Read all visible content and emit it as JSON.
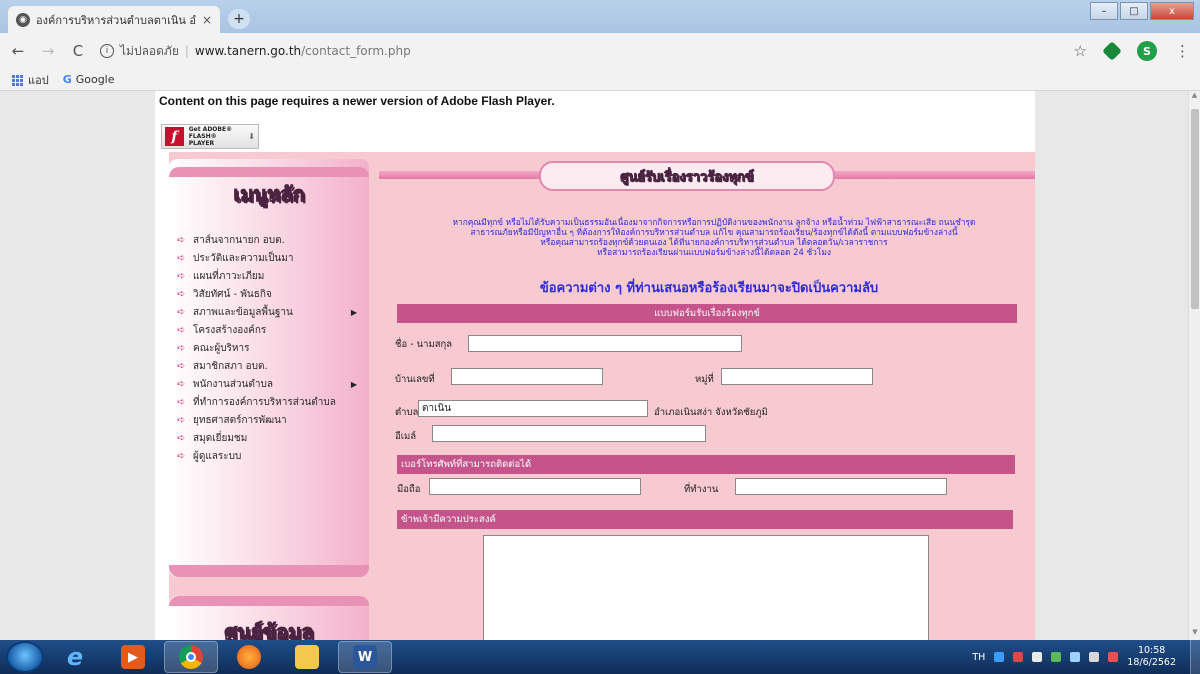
{
  "browser": {
    "tab_title": "องค์การบริหารส่วนตำบลตาเนิน อำเภอ",
    "tab_close": "×",
    "new_tab": "+",
    "not_secure": "ไม่ปลอดภัย",
    "domain": "www.tanern.go.th",
    "path": "/contact_form.php",
    "profile_letter": "S",
    "window_controls": [
      "–",
      "□",
      "x"
    ]
  },
  "bookmarks": {
    "apps_label": "แอป",
    "google_label": "Google"
  },
  "flash": {
    "message": "Content on this page requires a newer version of Adobe Flash Player.",
    "badge_line1": "Get ADOBE®",
    "badge_line2": "FLASH® PLAYER"
  },
  "sidebar": {
    "title": "เมนูหลัก",
    "items": [
      {
        "label": "สาส์นจากนายก อบต.",
        "has_sub": false
      },
      {
        "label": "ประวัติและความเป็นมา",
        "has_sub": false
      },
      {
        "label": "แผนที่ภาวะเภียม",
        "has_sub": false
      },
      {
        "label": "วิสัยทัศน์ - พันธกิจ",
        "has_sub": false
      },
      {
        "label": "สภาพและข้อมูลพื้นฐาน",
        "has_sub": true
      },
      {
        "label": "โครงสร้างองค์กร",
        "has_sub": false
      },
      {
        "label": "คณะผู้บริหาร",
        "has_sub": false
      },
      {
        "label": "สมาชิกสภา อบต.",
        "has_sub": false
      },
      {
        "label": "พนักงานส่วนตำบล",
        "has_sub": true
      },
      {
        "label": "ที่ทำการองค์การบริหารส่วนตำบล",
        "has_sub": false
      },
      {
        "label": "ยุทธศาสตร์การพัฒนา",
        "has_sub": false
      },
      {
        "label": "สมุดเยี่ยมชม",
        "has_sub": false
      },
      {
        "label": "ผู้ดูแลระบบ",
        "has_sub": false
      }
    ],
    "second_title": "ศูนย์ข้อมูล"
  },
  "main": {
    "header_title": "ศูนย์รับเรื่องราวร้องทุกข์",
    "notice_lines": [
      "หากคุณมีทุกข์ หรือไม่ได้รับความเป็นธรรมอันเนื่องมาจากกิจการหรือการปฏิบัติงานของพนักงาน ลูกจ้าง หรือน้ำท่วม ไฟฟ้าสาธารณะเสีย ถนนชำรุด",
      "สาธารณภัยหรือมีปัญหาอื่น ๆ ที่ต้องการให้องค์การบริหารส่วนตำบล แก้ไข คุณสามารถร้องเรียน/ร้องทุกข์ได้ดังนี้ ตามแบบฟอร์มข้างล่างนี้",
      "หรือคุณสามารถร้องทุกข์ด้วยตนเอง ได้ที่นายกองค์การบริหารส่วนตำบล ได้ตลอดวัน/เวลาราชการ",
      "หรือสามารถร้องเรียนผ่านแบบฟอร์มข้างล่างนี้ได้ตลอด 24 ชั่วโมง"
    ],
    "confidential_note": "ข้อความต่าง ๆ ที่ท่านเสนอหรือร้องเรียนมาจะปิดเป็นความลับ",
    "form_title": "แบบฟอร์มรับเรื่องร้องทุกข์",
    "name_label": "ชื่อ - นามสกุล",
    "house_no_label": "บ้านเลขที่",
    "moo_label": "หมู่ที่",
    "tambon_label": "ตำบล",
    "tambon_value": "ตาเนิน",
    "amphoe_province": "อำเภอเนินสง่า จังหวัดชัยภูมิ",
    "email_label": "อีเมล์",
    "phone_section": "เบอร์โทรศัพท์ที่สามารถติดต่อได้",
    "mobile_label": "มือถือ",
    "work_label": "ที่ทำงาน",
    "purpose_section": "ข้าพเจ้ามีความประสงค์"
  },
  "taskbar": {
    "language": "TH",
    "time": "10:58",
    "date": "18/6/2562",
    "word_label": "W"
  }
}
